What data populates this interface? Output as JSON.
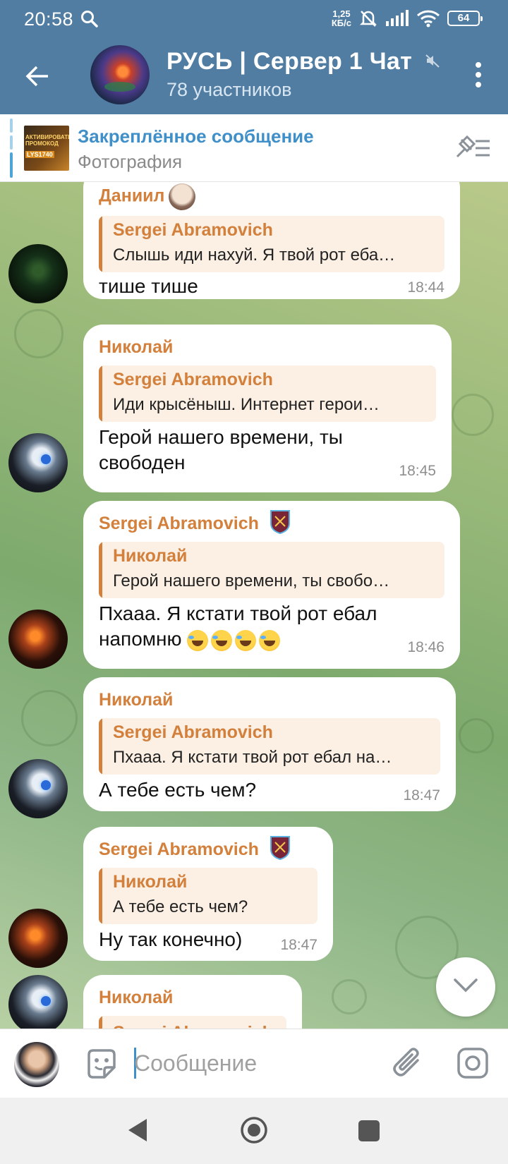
{
  "status_bar": {
    "time": "20:58",
    "net_speed_value": "1,25",
    "net_speed_unit": "КБ/с",
    "battery": "64"
  },
  "header": {
    "title": "РУСЬ | Сервер 1 Чат",
    "subtitle": "78 участников"
  },
  "pinned": {
    "title": "Закреплённое сообщение",
    "subtitle": "Фотография",
    "thumb_text_1": "АКТИВИРОВАТЬ ПРОМОКОД",
    "thumb_text_2": "LYS1740"
  },
  "messages": [
    {
      "sender": "Даниил",
      "reply_name": "Sergei Abramovich",
      "reply_text": "Слышь иди нахуй. Я твой рот еба…",
      "text": "тише тише",
      "time": "18:44"
    },
    {
      "sender": "Николай",
      "reply_name": "Sergei Abramovich",
      "reply_text": "Иди крысёныш. Интернет герои…",
      "text": "Герой нашего времени, ты свободен",
      "time": "18:45"
    },
    {
      "sender": "Sergei Abramovich",
      "reply_name": "Николай",
      "reply_text": "Герой нашего времени, ты свобо…",
      "text": "Пхааа. Я кстати твой рот ебал напомню",
      "time": "18:46"
    },
    {
      "sender": "Николай",
      "reply_name": "Sergei Abramovich",
      "reply_text": "Пхааа. Я кстати твой рот ебал на…",
      "text": "А тебе есть чем?",
      "time": "18:47"
    },
    {
      "sender": "Sergei Abramovich",
      "reply_name": "Николай",
      "reply_text": "А тебе есть чем?",
      "text": "Ну так конечно)",
      "time": "18:47"
    },
    {
      "sender": "Николай",
      "reply_name": "Sergei Abramovich",
      "reply_text": "",
      "text": "",
      "time": ""
    }
  ],
  "input": {
    "placeholder": "Сообщение"
  },
  "colors": {
    "header": "#517da2",
    "name": "#d2803c",
    "link": "#3f8fc9",
    "reply_bg": "#fcefe3"
  }
}
